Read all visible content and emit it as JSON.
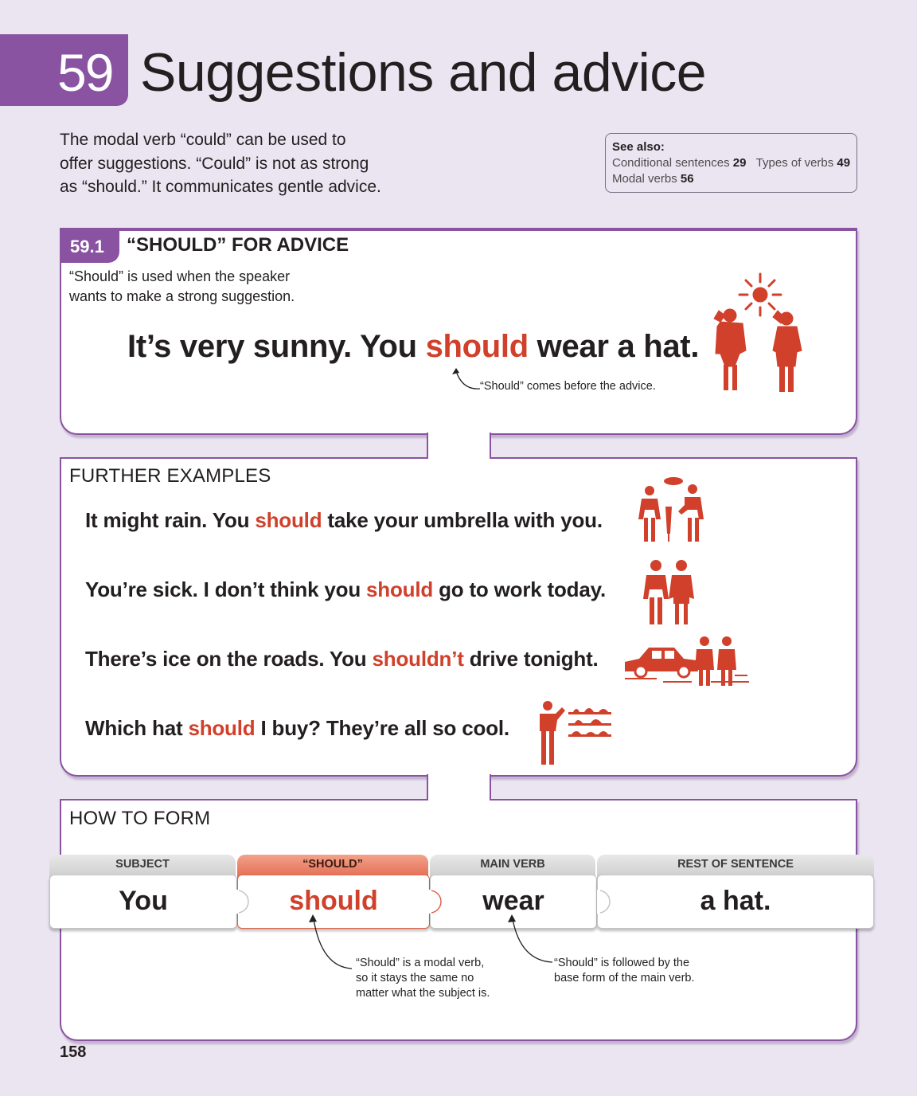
{
  "header": {
    "chapter_number": "59",
    "chapter_title": "Suggestions and advice",
    "intro_lines": [
      "The modal verb “could” can be used to",
      "offer suggestions. “Could” is not as strong",
      "as “should.” It communicates gentle advice."
    ]
  },
  "see_also": {
    "heading": "See also:",
    "refs": [
      {
        "label": "Conditional sentences",
        "num": "29"
      },
      {
        "label": "Types of verbs",
        "num": "49"
      },
      {
        "label": "Modal verbs",
        "num": "56"
      }
    ]
  },
  "section": {
    "number": "59.1",
    "title": "“SHOULD” FOR ADVICE",
    "desc_lines": [
      "“Should” is used when the speaker",
      "wants to make a strong suggestion."
    ],
    "main_sentence": {
      "before": "It’s very sunny. You ",
      "highlight": "should",
      "after": " wear a hat."
    },
    "main_note": "“Should” comes before the advice."
  },
  "further": {
    "heading": "FURTHER EXAMPLES",
    "examples": [
      {
        "before": "It might rain. You ",
        "highlight": "should",
        "after": " take your umbrella with you."
      },
      {
        "before": "You’re sick. I don’t think you ",
        "highlight": "should",
        "after": " go to work today."
      },
      {
        "before": "There’s ice on the roads. You ",
        "highlight": "shouldn’t",
        "after": " drive tonight."
      },
      {
        "before": "Which hat ",
        "highlight": "should",
        "after": " I buy? They’re all so cool."
      }
    ]
  },
  "how_to_form": {
    "heading": "HOW TO FORM",
    "tiles": [
      {
        "header": "SUBJECT",
        "word": "You"
      },
      {
        "header": "“SHOULD”",
        "word": "should"
      },
      {
        "header": "MAIN VERB",
        "word": "wear"
      },
      {
        "header": "REST OF SENTENCE",
        "word": "a hat."
      }
    ],
    "note_modal": [
      "“Should” is a modal verb,",
      "so it stays the same no",
      "matter what the subject is."
    ],
    "note_base": [
      "“Should” is followed by the",
      "base form of the main verb."
    ]
  },
  "page_number": "158",
  "colors": {
    "accent": "#8a53a2",
    "highlight": "#d0402a",
    "background": "#ebe4f1"
  }
}
